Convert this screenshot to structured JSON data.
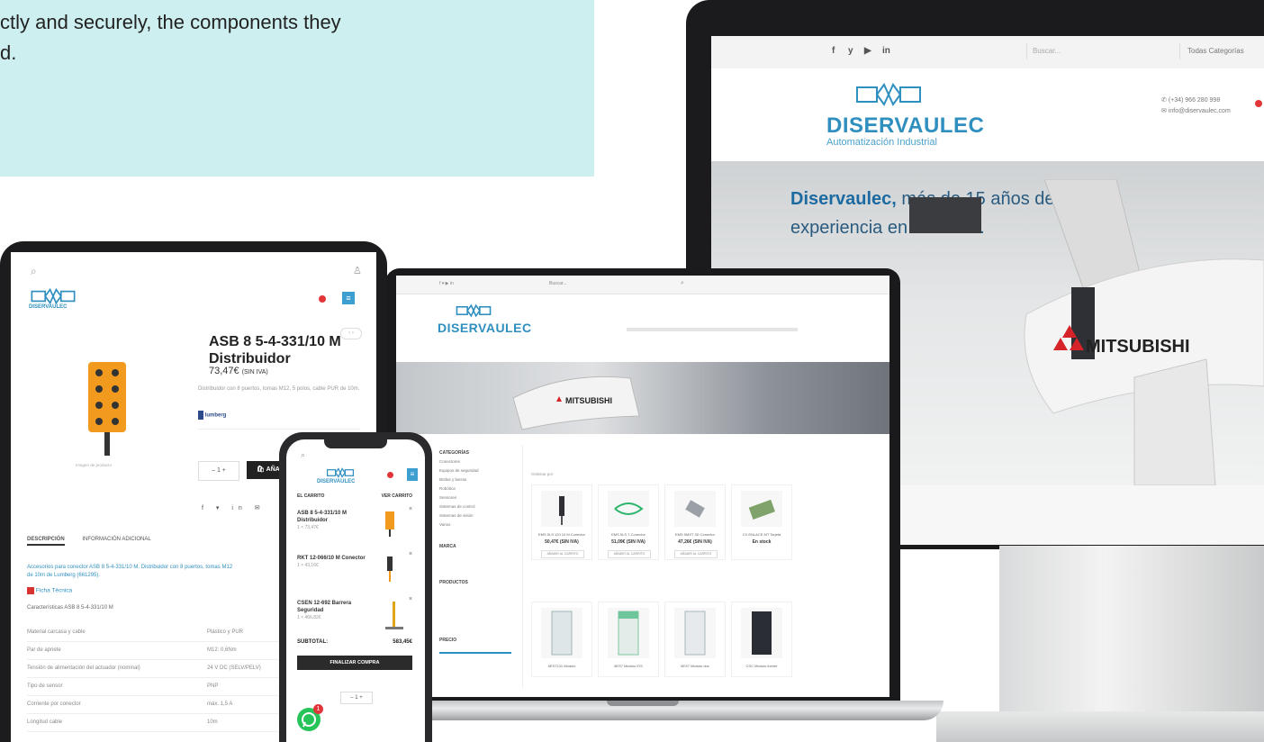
{
  "caption": {
    "line1": "ctly and securely, the components they",
    "line2": "d."
  },
  "colors": {
    "caption_bg": "#cdeff0",
    "brand_blue": "#2f8fbf",
    "device_black": "#1b1b1d",
    "whatsapp_green": "#27c45a",
    "badge_red": "#e1353a"
  },
  "monitor": {
    "social_icons": [
      "facebook-icon",
      "twitter-icon",
      "youtube-icon",
      "linkedin-icon"
    ],
    "social": [
      "f",
      "y",
      "▶",
      "in"
    ],
    "search_placeholder": "Buscar...",
    "category_select": "Todas Categorías",
    "logo_name": "DISERVAULEC",
    "logo_sub": "Automatización Industrial",
    "phone": "(+34) 966 280 998",
    "email": "info@diservaulec.com",
    "hero_brand": "Diservaulec,",
    "hero_rest": " más de 15 años de",
    "hero_line2": "experiencia en el sector.",
    "robot_label": "MITSUBISHI"
  },
  "laptop": {
    "logo_name": "DISERVAULEC",
    "search_placeholder": "Buscar...",
    "robot_label": "MITSUBISHI",
    "sidebar_categories_title": "CATEGORÍAS",
    "sidebar_categories": [
      "Conectores",
      "Equipos de seguridad",
      "Bridas y barras",
      "Robótica",
      "Sensores",
      "Sistemas de control",
      "Sistemas de visión",
      "Varios"
    ],
    "sidebar_brands_title": "MARCA",
    "sidebar_products_title": "PRODUCTOS",
    "sidebar_price_title": "PRECIO",
    "sort_label": "Ordenar por",
    "products": [
      {
        "title": "EMS 5LS 120 10 M Conector",
        "price": "50,47€ (SIN IVA)",
        "button": "AÑADIR AL CARRITO"
      },
      {
        "title": "EMS 5LS 7-Conector",
        "price": "51,09€ (SIN IVA)",
        "button": "AÑADIR AL CARRITO"
      },
      {
        "title": "EMS 5MST 3D Conector",
        "price": "47,26€ (SIN IVA)",
        "button": "AÑADIR AL CARRITO"
      },
      {
        "title": "CX ENLACE MT Tarjeta",
        "price": "En stock",
        "button": ""
      },
      {
        "title": "6ES7131 Módulo",
        "price": "",
        "button": ""
      },
      {
        "title": "6ES7 Módulo E/S",
        "price": "",
        "button": ""
      },
      {
        "title": "6ES7 Módulo dos",
        "price": "",
        "button": ""
      },
      {
        "title": "CSC Módulo fuente",
        "price": "",
        "button": ""
      }
    ]
  },
  "tablet": {
    "logo_name": "DISERVAULEC",
    "product_title_1": "ASB 8 5-4-331/10 M",
    "product_title_2": "Distribuidor",
    "price": "73,47€",
    "price_note": "(SIN IVA)",
    "description": "Distribuidor con 8 puertos, tomas M12, 5 polos, cable PUR de 10m.",
    "brand_badge": "lumberg",
    "image_caption": "Imagen de producto",
    "quantity": "1",
    "add_button": "AÑADIR",
    "tab_description": "DESCRIPCIÓN",
    "tab_additional": "INFORMACIÓN ADICIONAL",
    "desc_link": "Accesorios para conector ASB 8 5-4-331/10 M. Distribuidor con 8 puertos, tomas M12",
    "desc_link2": "de 10m de Lumberg (661295).",
    "datasheet": "Ficha Técnica",
    "specs_title": "Características ASB 8 5-4-331/10 M",
    "specs": [
      {
        "k": "Material carcasa y cable",
        "v": "Plástico y PUR"
      },
      {
        "k": "Par de apriete",
        "v": "M12: 0,6Nm"
      },
      {
        "k": "Tensión de alimentación del actuador (nominal)",
        "v": "24 V DC (SELV/PELV)"
      },
      {
        "k": "Tipo de sensor",
        "v": "PNP"
      },
      {
        "k": "Corriente por conector",
        "v": "máx. 1,5 A"
      },
      {
        "k": "Longitud cable",
        "v": "10m"
      }
    ]
  },
  "phone": {
    "logo_name": "DISERVAULEC",
    "cart_header_left": "EL CARRITO",
    "cart_header_right": "VER CARRITO",
    "items": [
      {
        "name": "ASB 8 5-4-331/10 M Distribuidor",
        "qty": "1 × 73,47€"
      },
      {
        "name": "RKT 12-066/10 M Conector",
        "qty": "1 × 43,16€"
      },
      {
        "name": "CSEN 12-692 Barrera Seguridad",
        "qty": "1 × 466,82€"
      }
    ],
    "subtotal_label": "SUBTOTAL:",
    "subtotal_value": "583,45€",
    "checkout": "FINALIZAR COMPRA",
    "quantity": "1",
    "badge_count": "1"
  }
}
